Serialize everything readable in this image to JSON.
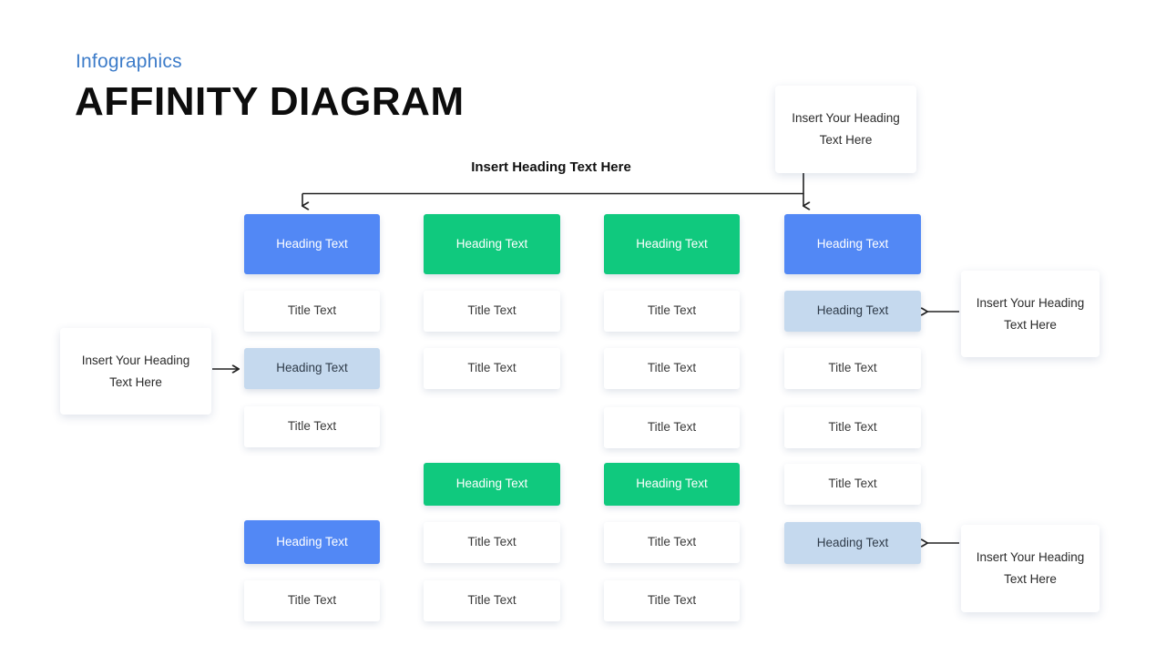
{
  "header": {
    "eyebrow": "Infographics",
    "title": "AFFINITY DIAGRAM"
  },
  "top_heading": "Insert Heading Text Here",
  "labels": {
    "heading_text": "Heading Text",
    "title_text": "Title Text",
    "callout_text": "Insert Your Heading Text Here"
  },
  "colors": {
    "blue": "#5288f5",
    "green": "#10c97e",
    "light_blue": "#c5d9ee",
    "white": "#ffffff",
    "eyebrow": "#3d7cc9",
    "title": "#0d0d0d",
    "connector": "#222222"
  },
  "callouts": [
    {
      "id": "callout-top",
      "text": "Insert Your Heading Text Here"
    },
    {
      "id": "callout-left",
      "text": "Insert Your Heading Text Here"
    },
    {
      "id": "callout-right-upper",
      "text": "Insert Your Heading Text Here"
    },
    {
      "id": "callout-right-lower",
      "text": "Insert Your Heading Text Here"
    }
  ],
  "columns": [
    {
      "id": "column-1",
      "boxes": [
        {
          "kind": "heading",
          "color": "blue",
          "text": "Heading Text"
        },
        {
          "kind": "title",
          "color": "white",
          "text": "Title Text"
        },
        {
          "kind": "heading",
          "color": "light_blue",
          "text": "Heading Text"
        },
        {
          "kind": "title",
          "color": "white",
          "text": "Title Text"
        },
        {
          "kind": "heading",
          "color": "blue",
          "text": "Heading Text"
        },
        {
          "kind": "title",
          "color": "white",
          "text": "Title Text"
        }
      ]
    },
    {
      "id": "column-2",
      "boxes": [
        {
          "kind": "heading",
          "color": "green",
          "text": "Heading Text"
        },
        {
          "kind": "title",
          "color": "white",
          "text": "Title Text"
        },
        {
          "kind": "title",
          "color": "white",
          "text": "Title Text"
        },
        {
          "kind": "heading",
          "color": "green",
          "text": "Heading Text"
        },
        {
          "kind": "title",
          "color": "white",
          "text": "Title Text"
        },
        {
          "kind": "title",
          "color": "white",
          "text": "Title Text"
        }
      ]
    },
    {
      "id": "column-3",
      "boxes": [
        {
          "kind": "heading",
          "color": "green",
          "text": "Heading Text"
        },
        {
          "kind": "title",
          "color": "white",
          "text": "Title Text"
        },
        {
          "kind": "title",
          "color": "white",
          "text": "Title Text"
        },
        {
          "kind": "title",
          "color": "white",
          "text": "Title Text"
        },
        {
          "kind": "heading",
          "color": "green",
          "text": "Heading Text"
        },
        {
          "kind": "title",
          "color": "white",
          "text": "Title Text"
        },
        {
          "kind": "title",
          "color": "white",
          "text": "Title Text"
        }
      ]
    },
    {
      "id": "column-4",
      "boxes": [
        {
          "kind": "heading",
          "color": "blue",
          "text": "Heading Text"
        },
        {
          "kind": "heading",
          "color": "light_blue",
          "text": "Heading Text"
        },
        {
          "kind": "title",
          "color": "white",
          "text": "Title Text"
        },
        {
          "kind": "title",
          "color": "white",
          "text": "Title Text"
        },
        {
          "kind": "title",
          "color": "white",
          "text": "Title Text"
        },
        {
          "kind": "heading",
          "color": "light_blue",
          "text": "Heading Text"
        }
      ]
    }
  ]
}
